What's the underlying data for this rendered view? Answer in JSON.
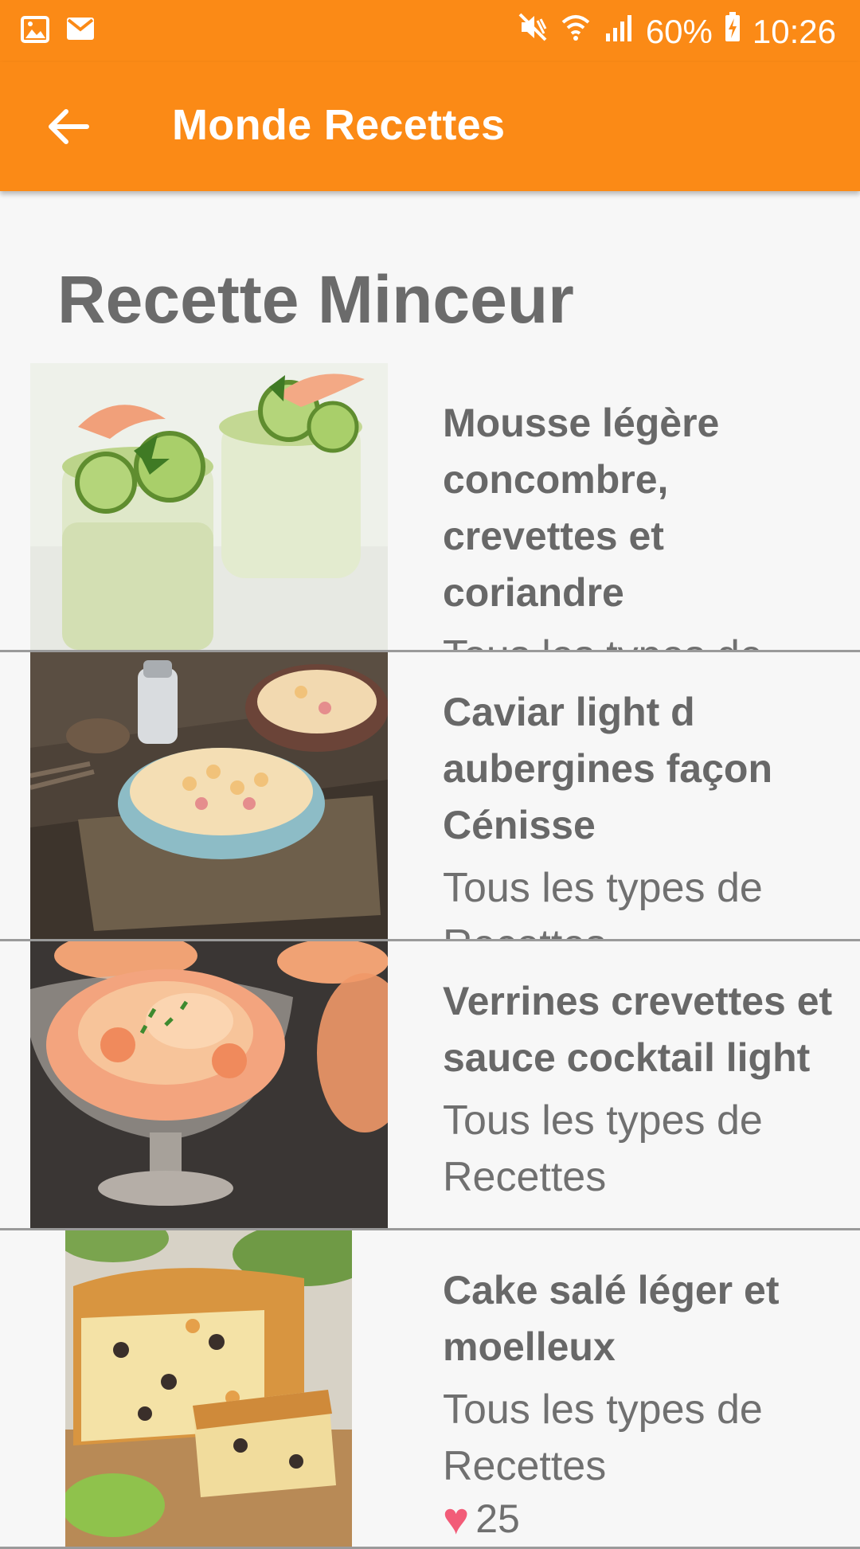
{
  "status_bar": {
    "left_icons": [
      "image-icon",
      "mail-icon"
    ],
    "battery_percent": "60%",
    "time": "10:26",
    "right_icons": [
      "mute-icon",
      "wifi-icon",
      "signal-icon",
      "battery-charging-icon"
    ]
  },
  "app_bar": {
    "title": "Monde Recettes",
    "back_icon": "arrow-left-icon",
    "background": "#fb8a16"
  },
  "section": {
    "title": "Recette Minceur"
  },
  "recipes": [
    {
      "title": "Mousse légère concombre, crevettes et coriandre",
      "subtitle": "Tous les types de Recettes",
      "image": "cucumber-shrimp-mousse-photo"
    },
    {
      "title": "Caviar light d aubergines façon Cénisse",
      "subtitle": "Tous les types de Recettes",
      "image": "chickpea-salad-photo"
    },
    {
      "title": "Verrines crevettes et sauce cocktail light",
      "subtitle": "Tous les types de Recettes",
      "image": "shrimp-cocktail-verrine-photo"
    },
    {
      "title": "Cake salé léger et moelleux",
      "subtitle": "Tous les types de Recettes",
      "likes": "25",
      "image": "savory-cake-photo"
    }
  ]
}
